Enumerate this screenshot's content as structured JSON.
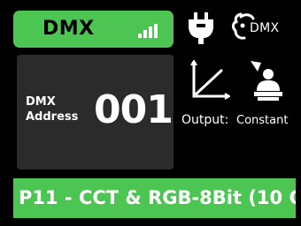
{
  "status": {
    "badge_label": "DMX",
    "signal_icon": "signal-strength-icon",
    "signal_bars": 4,
    "connector_icon": "power-plug-icon",
    "rdm_icon": "rdm-dmx-icon",
    "rdm_label": "DMX"
  },
  "address": {
    "label_line1": "DMX",
    "label_line2": "Address",
    "value": "001"
  },
  "output": {
    "curve_icon": "dimming-curve-icon",
    "mode_icon": "person-icon",
    "label": "Output:",
    "value": "Constant"
  },
  "mode": {
    "text": "P11 - CCT & RGB-8Bit (10 C"
  },
  "colors": {
    "accent_green": "#4cc552",
    "panel_gray": "#2b2b2b",
    "background": "#000000",
    "text": "#ffffff"
  }
}
